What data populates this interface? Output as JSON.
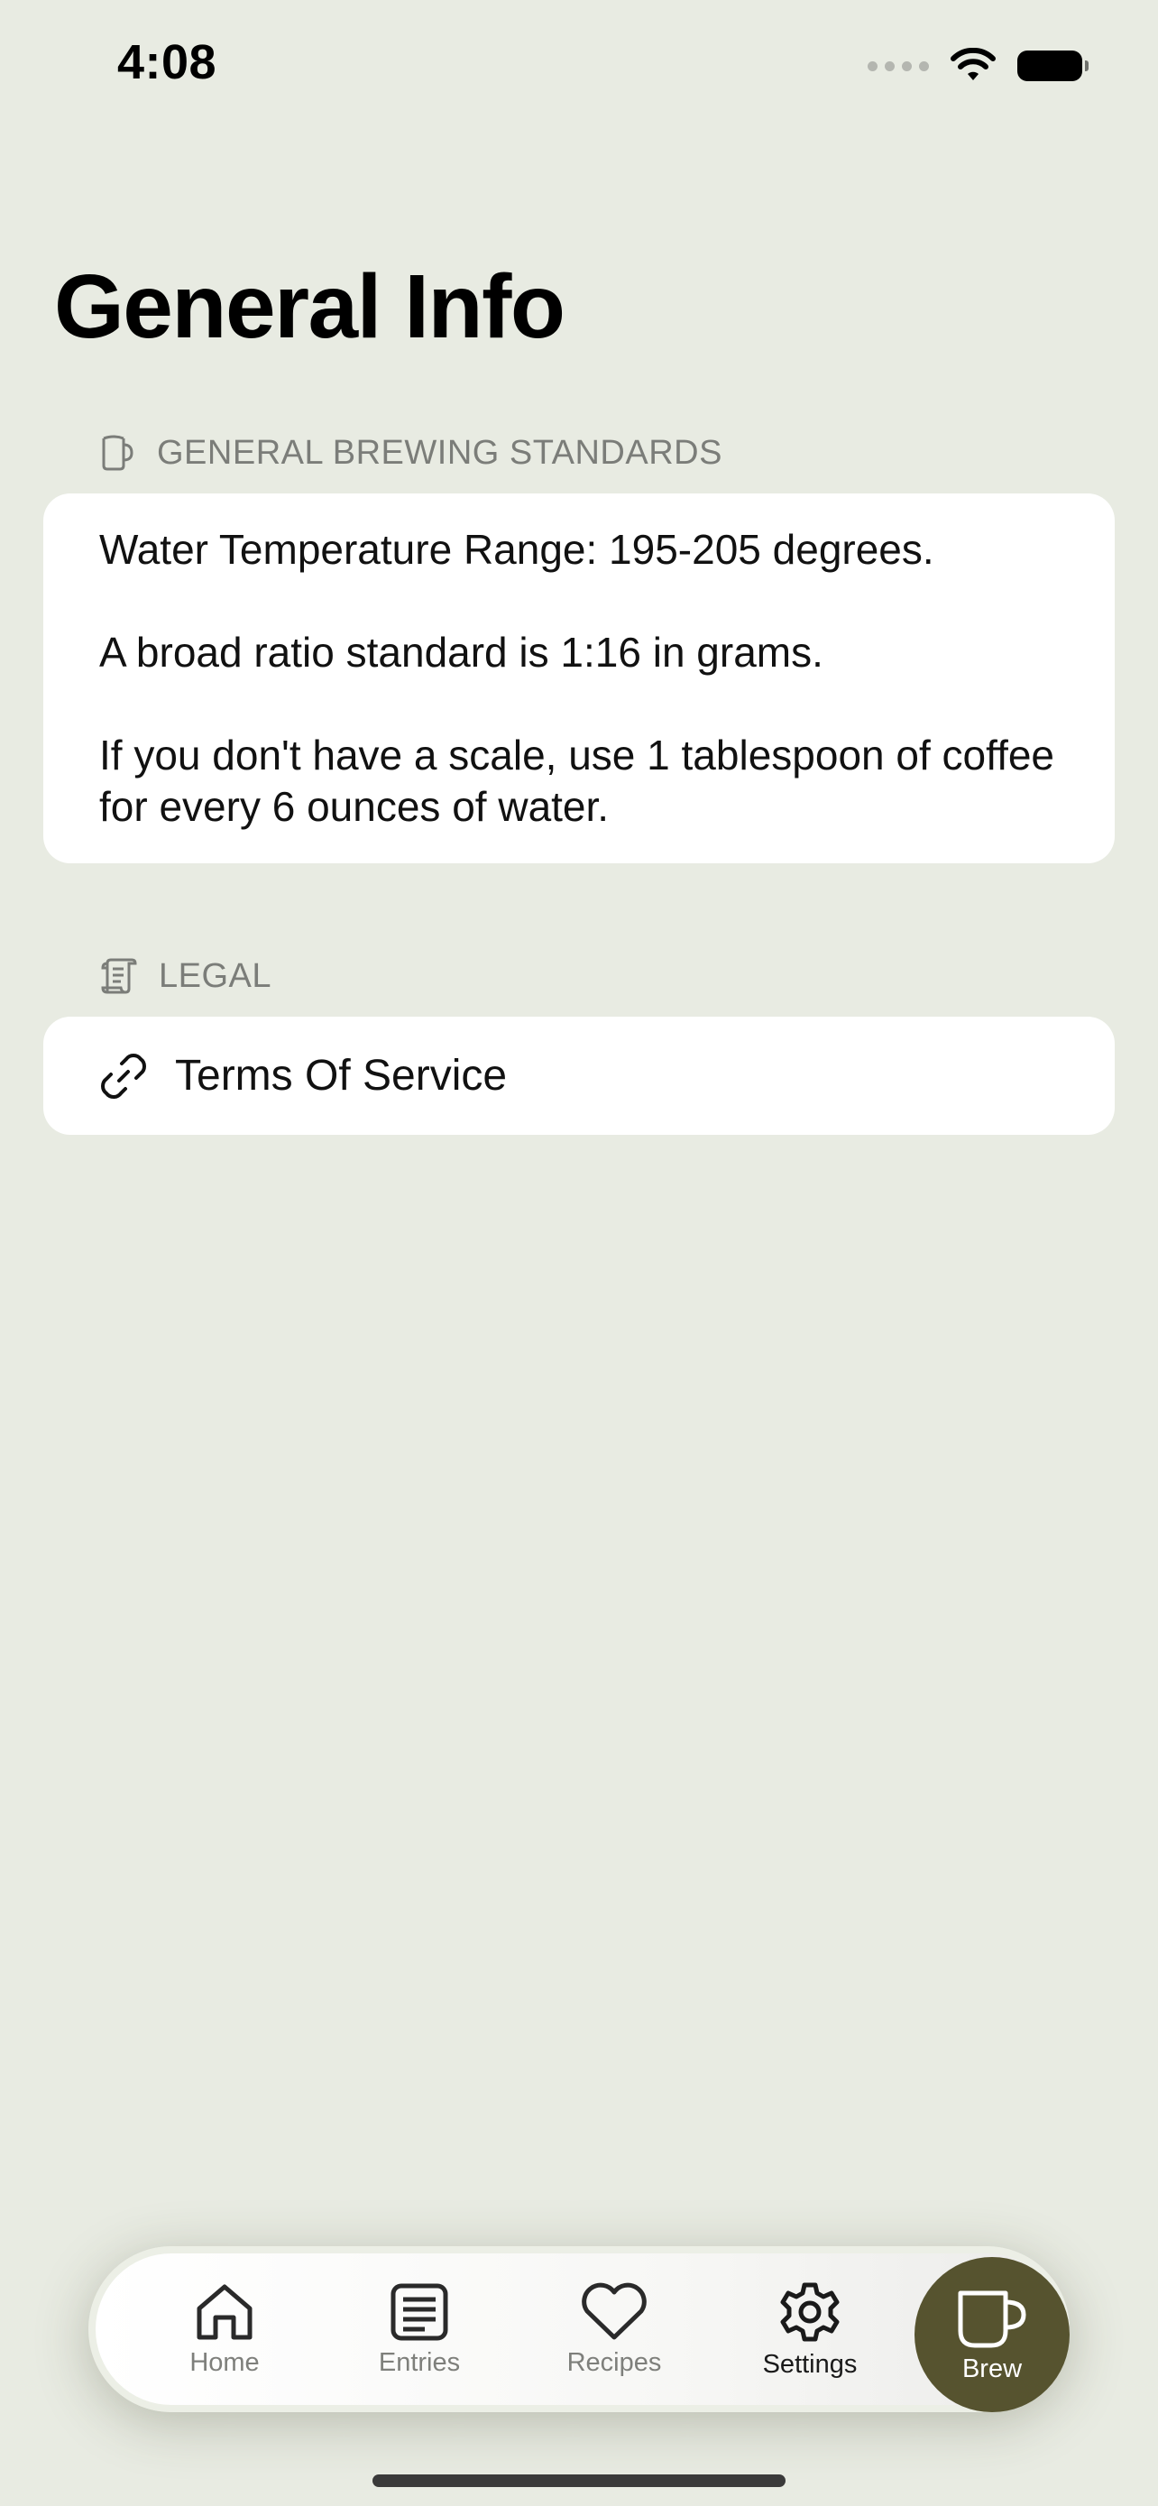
{
  "status_bar": {
    "time": "4:08"
  },
  "page": {
    "title": "General Info"
  },
  "sections": {
    "brewing": {
      "header": "GENERAL BREWING STANDARDS",
      "icon": "mug-icon",
      "paragraphs": [
        "Water Temperature Range: 195-205 degrees.",
        "A broad ratio standard is 1:16 in grams.",
        "If you don't have a scale, use 1 tablespoon of coffee for every 6 ounces of water."
      ]
    },
    "legal": {
      "header": "LEGAL",
      "icon": "scroll-icon",
      "link_label": "Terms Of Service",
      "link_icon": "link-icon"
    }
  },
  "tab_bar": {
    "tabs": [
      {
        "label": "Home",
        "icon": "home-icon",
        "active": false
      },
      {
        "label": "Entries",
        "icon": "entries-icon",
        "active": false
      },
      {
        "label": "Recipes",
        "icon": "heart-icon",
        "active": false
      },
      {
        "label": "Settings",
        "icon": "gear-icon",
        "active": true
      }
    ],
    "brew": {
      "label": "Brew",
      "icon": "cup-icon"
    }
  },
  "colors": {
    "background": "#e8ebe2",
    "card": "#ffffff",
    "brew_button": "#56532f",
    "muted_text": "#7b7d79"
  }
}
